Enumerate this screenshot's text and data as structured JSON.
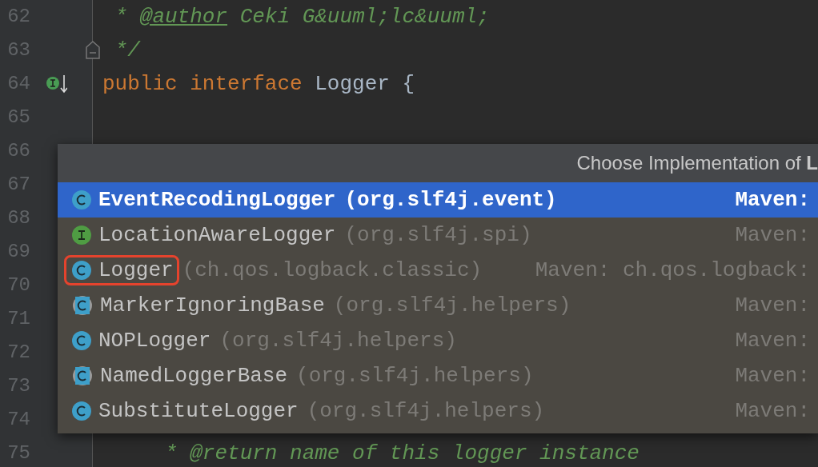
{
  "editor": {
    "lines": [
      {
        "number": "62",
        "tokens": [
          {
            "kind": "comment",
            "text": " * "
          },
          {
            "kind": "doctag",
            "text": "@author"
          },
          {
            "kind": "comment",
            "text": " Ceki G&uuml;lc&uuml;"
          }
        ]
      },
      {
        "number": "63",
        "gutter": {
          "kind": "fold"
        },
        "tokens": [
          {
            "kind": "comment",
            "text": " */"
          }
        ]
      },
      {
        "number": "64",
        "gutter": {
          "kind": "implemented"
        },
        "tokens": [
          {
            "kind": "keyword",
            "text": "public interface "
          },
          {
            "kind": "plain",
            "text": "Logger {"
          }
        ]
      },
      {
        "number": "65"
      },
      {
        "number": "66"
      },
      {
        "number": "67"
      },
      {
        "number": "68"
      },
      {
        "number": "69"
      },
      {
        "number": "70"
      },
      {
        "number": "71"
      },
      {
        "number": "72"
      },
      {
        "number": "73"
      },
      {
        "number": "74"
      },
      {
        "number": "75",
        "tokens": [
          {
            "kind": "comment",
            "text": "     * @return name of this logger instance"
          }
        ]
      }
    ]
  },
  "popup": {
    "title": "Choose Implementation of **L**",
    "items": [
      {
        "kind": "class",
        "name": "EventRecodingLogger",
        "package": "(org.slf4j.event)",
        "source": "Maven:",
        "selected": true,
        "annotated": false
      },
      {
        "kind": "interface",
        "name": "LocationAwareLogger",
        "package": "(org.slf4j.spi)",
        "source": "Maven:",
        "selected": false,
        "annotated": false
      },
      {
        "kind": "class",
        "name": "Logger",
        "package": "(ch.qos.logback.classic)",
        "source": "Maven: ch.qos.logback:",
        "selected": false,
        "annotated": true
      },
      {
        "kind": "abstract",
        "name": "MarkerIgnoringBase",
        "package": "(org.slf4j.helpers)",
        "source": "Maven:",
        "selected": false,
        "annotated": false
      },
      {
        "kind": "class",
        "name": "NOPLogger",
        "package": "(org.slf4j.helpers)",
        "source": "Maven:",
        "selected": false,
        "annotated": false
      },
      {
        "kind": "abstract",
        "name": "NamedLoggerBase",
        "package": "(org.slf4j.helpers)",
        "source": "Maven:",
        "selected": false,
        "annotated": false
      },
      {
        "kind": "class",
        "name": "SubstituteLogger",
        "package": "(org.slf4j.helpers)",
        "source": "Maven:",
        "selected": false,
        "annotated": false
      }
    ]
  }
}
